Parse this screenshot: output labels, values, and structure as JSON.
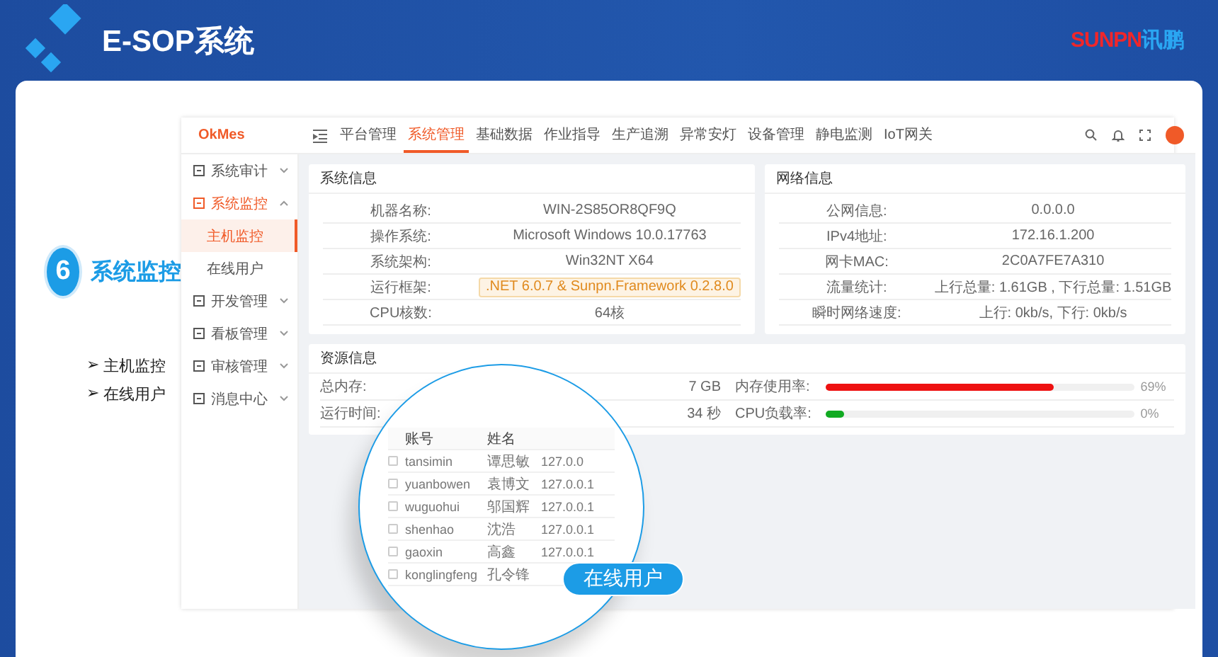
{
  "header": {
    "title": "E-SOP系统",
    "logo": {
      "brand": "SUNPN",
      "suffix": "讯鹏"
    }
  },
  "intro": {
    "step": "6",
    "title": "系统监控",
    "bullets": [
      {
        "marker": "➢",
        "text": "主机监控"
      },
      {
        "marker": "➢",
        "text": "在线用户"
      }
    ]
  },
  "app": {
    "logo": "OkMes",
    "sidebar": [
      {
        "label": "系统审计",
        "expanded": false,
        "selected": false
      },
      {
        "label": "系统监控",
        "expanded": true,
        "selected": true,
        "children": [
          {
            "label": "主机监控",
            "selected": true
          },
          {
            "label": "在线用户",
            "selected": false
          }
        ]
      },
      {
        "label": "开发管理",
        "expanded": false,
        "selected": false
      },
      {
        "label": "看板管理",
        "expanded": false,
        "selected": false
      },
      {
        "label": "审核管理",
        "expanded": false,
        "selected": false
      },
      {
        "label": "消息中心",
        "expanded": false,
        "selected": false
      }
    ],
    "nav": [
      {
        "label": "平台管理",
        "selected": false
      },
      {
        "label": "系统管理",
        "selected": true
      },
      {
        "label": "基础数据",
        "selected": false
      },
      {
        "label": "作业指导",
        "selected": false
      },
      {
        "label": "生产追溯",
        "selected": false
      },
      {
        "label": "异常安灯",
        "selected": false
      },
      {
        "label": "设备管理",
        "selected": false
      },
      {
        "label": "静电监测",
        "selected": false
      },
      {
        "label": "IoT网关",
        "selected": false
      }
    ],
    "system_info": {
      "title": "系统信息",
      "rows": [
        {
          "kind": "text",
          "label": "机器名称:",
          "value": "WIN-2S85OR8QF9Q"
        },
        {
          "kind": "text",
          "label": "操作系统:",
          "value": "Microsoft Windows 10.0.17763"
        },
        {
          "kind": "text",
          "label": "系统架构:",
          "value": "Win32NT X64"
        },
        {
          "kind": "tag",
          "label": "运行框架:",
          "value": ".NET 6.0.7 & Sunpn.Framework 0.2.8.0"
        },
        {
          "kind": "text",
          "label": "CPU核数:",
          "value": "64核"
        }
      ]
    },
    "network_info": {
      "title": "网络信息",
      "rows": [
        {
          "kind": "text",
          "label": "公网信息:",
          "value": "0.0.0.0"
        },
        {
          "kind": "text",
          "label": "IPv4地址:",
          "value": "172.16.1.200"
        },
        {
          "kind": "text",
          "label": "网卡MAC:",
          "value": "2C0A7FE7A310"
        },
        {
          "kind": "text",
          "label": "流量统计:",
          "value": "上行总量: 1.61GB , 下行总量: 1.51GB"
        },
        {
          "kind": "text",
          "label": "瞬时网络速度:",
          "value": "上行: 0kb/s, 下行: 0kb/s"
        }
      ]
    },
    "resources": {
      "title": "资源信息",
      "rows": [
        {
          "label": "总内存:",
          "value": "7 GB"
        },
        {
          "label": "运行时间:",
          "value": "34 秒"
        }
      ],
      "meters": [
        {
          "label": "内存使用率:",
          "level": 0.74,
          "reading": "69%",
          "color": "#ee1111"
        },
        {
          "label": "CPU负载率:",
          "level": 0.06,
          "reading": "0%",
          "color": "#11aa22"
        }
      ]
    }
  },
  "lens": {
    "label": "在线用户",
    "columns": [
      "账号",
      "姓名"
    ],
    "rows": [
      {
        "checked": false,
        "cells": [
          "tansimin",
          "谭思敏",
          "127.0.0"
        ]
      },
      {
        "checked": false,
        "cells": [
          "yuanbowen",
          "袁博文",
          "127.0.0.1"
        ]
      },
      {
        "checked": false,
        "cells": [
          "wuguohui",
          "邬国辉",
          "127.0.0.1"
        ]
      },
      {
        "checked": false,
        "cells": [
          "shenhao",
          "沈浩",
          "127.0.0.1"
        ]
      },
      {
        "checked": false,
        "cells": [
          "gaoxin",
          "高鑫",
          "127.0.0.1"
        ]
      },
      {
        "checked": false,
        "cells": [
          "konglingfeng",
          "孔令锋"
        ]
      }
    ]
  }
}
